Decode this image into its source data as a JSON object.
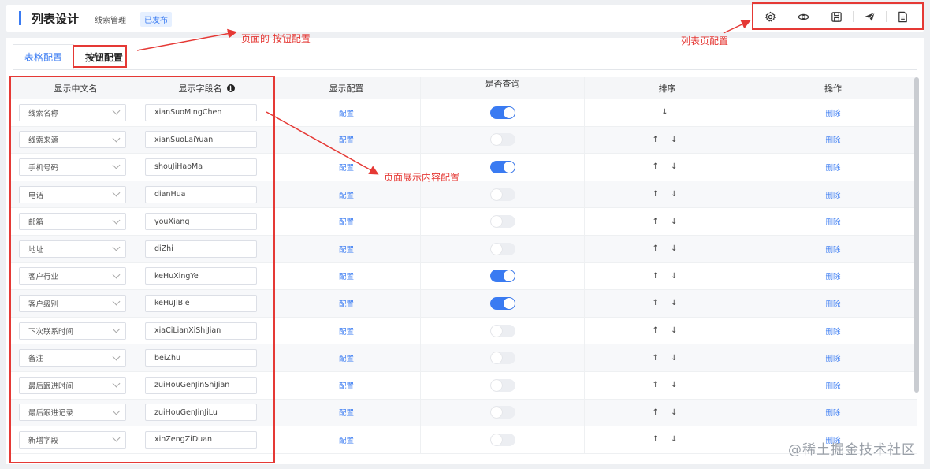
{
  "header": {
    "title": "列表设计",
    "breadcrumb": "线索管理",
    "status_badge": "已发布",
    "tools": [
      {
        "icon": "settings-gear-icon"
      },
      {
        "icon": "eye-icon"
      },
      {
        "icon": "save-icon"
      },
      {
        "icon": "send-icon"
      },
      {
        "icon": "document-icon"
      }
    ]
  },
  "tabs": {
    "table_config": "表格配置",
    "button_config": "按钮配置"
  },
  "table": {
    "headers": {
      "display_name": "显示中文名",
      "field_name": "显示字段名",
      "display_config": "显示配置",
      "is_query": "是否查询",
      "sort": "排序",
      "action": "操作"
    },
    "config_link": "配置",
    "delete_link": "删除",
    "rows": [
      {
        "display_name": "线索名称",
        "field_name": "xianSuoMingChen",
        "query": true,
        "sort": "↓"
      },
      {
        "display_name": "线索来源",
        "field_name": "xianSuoLaiYuan",
        "query": false,
        "sort": "↑ ↓"
      },
      {
        "display_name": "手机号码",
        "field_name": "shouJiHaoMa",
        "query": true,
        "sort": "↑ ↓"
      },
      {
        "display_name": "电话",
        "field_name": "dianHua",
        "query": false,
        "sort": "↑ ↓"
      },
      {
        "display_name": "邮箱",
        "field_name": "youXiang",
        "query": false,
        "sort": "↑ ↓"
      },
      {
        "display_name": "地址",
        "field_name": "diZhi",
        "query": false,
        "sort": "↑ ↓"
      },
      {
        "display_name": "客户行业",
        "field_name": "keHuXingYe",
        "query": true,
        "sort": "↑ ↓"
      },
      {
        "display_name": "客户级别",
        "field_name": "keHuJiBie",
        "query": true,
        "sort": "↑ ↓"
      },
      {
        "display_name": "下次联系时间",
        "field_name": "xiaCiLianXiShiJian",
        "query": false,
        "sort": "↑ ↓"
      },
      {
        "display_name": "备注",
        "field_name": "beiZhu",
        "query": false,
        "sort": "↑ ↓"
      },
      {
        "display_name": "最后跟进时间",
        "field_name": "zuiHouGenJinShiJian",
        "query": false,
        "sort": "↑ ↓"
      },
      {
        "display_name": "最后跟进记录",
        "field_name": "zuiHouGenJinJiLu",
        "query": false,
        "sort": "↑ ↓"
      },
      {
        "display_name": "新增字段",
        "field_name": "xinZengZiDuan",
        "query": false,
        "sort": "↑ ↓"
      }
    ]
  },
  "annotations": {
    "button_config_note": "页面的 按钮配置",
    "list_page_note": "列表页配置",
    "content_note": "页面展示内容配置"
  },
  "watermark": "@稀土掘金技术社区",
  "colors": {
    "accent": "#3a7bf2",
    "annotation": "#e53935"
  }
}
